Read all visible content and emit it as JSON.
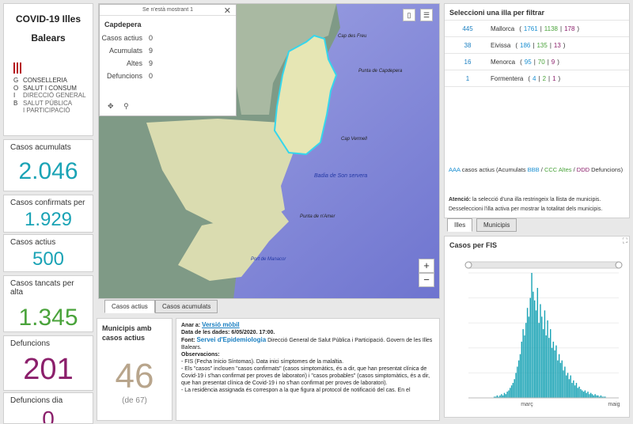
{
  "header": {
    "title_line1": "COVID-19 Illes",
    "title_line2": "Balears",
    "org_lines": [
      "CONSELLERIA",
      "SALUT I CONSUM",
      "DIRECCIÓ GENERAL",
      "SALUT PÚBLICA",
      "I PARTICIPACIÓ"
    ],
    "org_letters": [
      "G",
      "O",
      "I",
      "B"
    ]
  },
  "stats": {
    "cumulative": {
      "label": "Casos acumulats",
      "value": "2.046",
      "color": "#1aa3b5"
    },
    "confirmed": {
      "label": "Casos confirmats per",
      "value": "1.929",
      "color": "#1aa3b5"
    },
    "active": {
      "label": "Casos actius",
      "value": "500",
      "color": "#1aa3b5"
    },
    "discharged": {
      "label": "Casos tancats per alta",
      "value": "1.345",
      "color": "#4aa33b"
    },
    "deaths": {
      "label": "Defuncions",
      "value": "201",
      "color": "#8b1f6b"
    },
    "deaths_day": {
      "label": "Defuncions dia",
      "value": "0",
      "color": "#8b1f6b"
    }
  },
  "map": {
    "popup": {
      "header": "Se n'està mostrant 1",
      "name": "Capdepera",
      "rows": [
        {
          "k": "Casos actius",
          "v": "0"
        },
        {
          "k": "Acumulats",
          "v": "9"
        },
        {
          "k": "Altes",
          "v": "9"
        },
        {
          "k": "Defuncions",
          "v": "0"
        }
      ]
    },
    "labels": [
      "Cap des Freu",
      "Punta de Capdepera",
      "Cap Vermell",
      "Badia de Son servera",
      "Punta de n'Amer",
      "Port de Manacor"
    ],
    "zoom_in": "+",
    "zoom_out": "−"
  },
  "bottom_tabs": [
    "Casos actius",
    "Casos acumulats"
  ],
  "municipis": {
    "title": "Municipis amb casos actius",
    "value": "46",
    "sub": "(de 67)"
  },
  "notes": {
    "area_label": "Anar a:",
    "area_link": "Versió mòbil",
    "date_label": "Data de les dades:",
    "date_value": "6/05/2020. 17:00.",
    "font_label": "Font:",
    "font_link": "Servei d'Epidemiologia",
    "font_text": "Direcció General de Salut Pública i Participació. Govern de les Illes Balears.",
    "obs_label": "Observacions:",
    "obs1": "- FIS (Fecha Inicio Síntomas). Data inici símptomes de la malaltia.",
    "obs2": "- Els \"casos\" inclouen \"casos confirmats\" (casos simptomàtics, és a dir, que han presentat clínica de Covid-19 i s'han confirmat per proves de laboratori) i \"casos probables\" (casos simptomàtics, és a dir, que han presentat clínica de Covid-19 i no s'han confirmat per proves de laboratori).",
    "obs3": "- La residència assignada és correspon a la que figura al protocol de notificació del cas. En el"
  },
  "islands": {
    "title": "Seleccioni una illa per filtrar",
    "rows": [
      {
        "count": "445",
        "name": "Mallorca",
        "a": "1761",
        "b": "1138",
        "c": "178"
      },
      {
        "count": "38",
        "name": "Eivissa",
        "a": "186",
        "b": "135",
        "c": "13"
      },
      {
        "count": "16",
        "name": "Menorca",
        "a": "95",
        "b": "70",
        "c": "9"
      },
      {
        "count": "1",
        "name": "Formentera",
        "a": "4",
        "b": "2",
        "c": "1"
      }
    ],
    "legend_aaa": "AAA",
    "legend_text1": "casos actius (Acumulats",
    "legend_bbb": "BBB",
    "legend_ccc": "CCC Altes",
    "legend_ddd": "DDD",
    "legend_text2": "Defuncions)",
    "attention_label": "Atenció:",
    "attention_text": "la selecció d'una illa restringeix la llista de municipis. Desseleccioni l'illa activa per mostrar la totalitat dels municipis.",
    "tabs": [
      "Illes",
      "Municipis"
    ]
  },
  "chart_data": {
    "type": "bar",
    "title": "Casos per FIS",
    "xticks": [
      "març",
      "maig"
    ],
    "ylim": [
      0,
      100
    ],
    "values": [
      1,
      1,
      2,
      1,
      2,
      3,
      2,
      4,
      3,
      5,
      6,
      8,
      10,
      12,
      15,
      20,
      25,
      30,
      35,
      45,
      55,
      50,
      60,
      72,
      65,
      80,
      100,
      85,
      78,
      70,
      88,
      60,
      75,
      65,
      55,
      70,
      50,
      62,
      48,
      55,
      40,
      45,
      38,
      42,
      30,
      35,
      28,
      30,
      22,
      25,
      18,
      20,
      15,
      18,
      12,
      14,
      10,
      12,
      8,
      9,
      7,
      6,
      5,
      6,
      4,
      5,
      3,
      4,
      3,
      2,
      3,
      2,
      2,
      1,
      2,
      1,
      1,
      1
    ],
    "color": "#1aa3b5"
  }
}
